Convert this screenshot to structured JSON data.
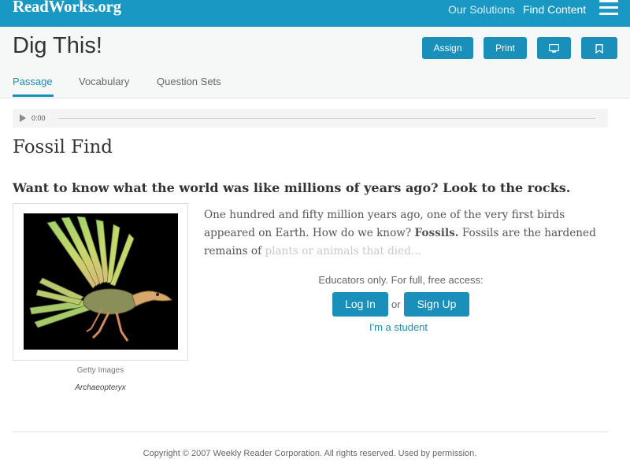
{
  "header": {
    "logo": "ReadWorks.org",
    "nav": [
      {
        "label": "Our Solutions"
      },
      {
        "label": "Find Content"
      }
    ],
    "menu_icon": "hamburger-menu-icon"
  },
  "page": {
    "title": "Dig This!",
    "actions": {
      "assign_label": "Assign",
      "print_label": "Print",
      "present_icon": "monitor-icon",
      "bookmark_icon": "bookmark-icon"
    },
    "tabs": [
      {
        "label": "Passage",
        "active": true
      },
      {
        "label": "Vocabulary",
        "active": false
      },
      {
        "label": "Question Sets",
        "active": false
      }
    ]
  },
  "audio": {
    "time": "0:00",
    "progress": 0,
    "play_icon": "play-icon"
  },
  "article": {
    "title": "Fossil Find",
    "subtitle": "Want to know what the world was like millions of years ago? Look to the rocks.",
    "image_credit": "Getty Images",
    "image_caption": "Archaeopteryx",
    "passage_before": "One hundred and fifty million years ago, one of the very first birds appeared on Earth. How do we know? ",
    "passage_bold": "Fossils.",
    "passage_after": " Fossils are the hardened remains of ",
    "passage_faded": "plants or animals that died..."
  },
  "access": {
    "prompt": "Educators only. For full, free access:",
    "login_label": "Log In",
    "or_label": "or",
    "signup_label": "Sign Up",
    "student_link": "I'm a student"
  },
  "footer": {
    "copyright": "Copyright © 2007 Weekly Reader Corporation. All rights reserved. Used by permission."
  },
  "colors": {
    "brand": "#1a98c4",
    "button": "#1a8fba",
    "title_band": "#f6f7f7"
  }
}
